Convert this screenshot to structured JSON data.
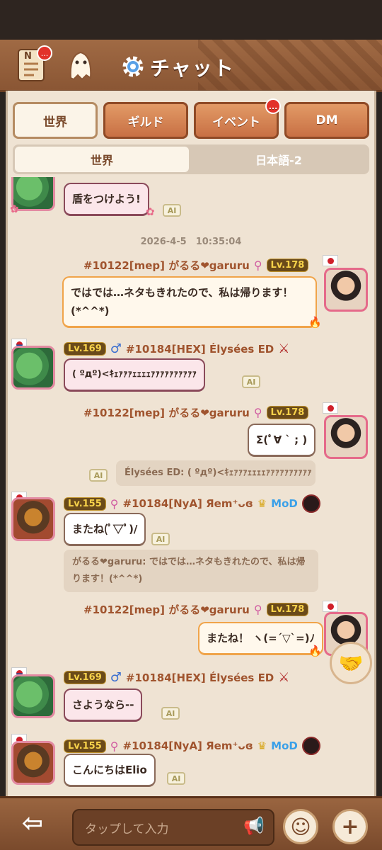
{
  "header": {
    "title": "チャット",
    "news_badge": "...",
    "news_icon_letter": "N"
  },
  "tabs": [
    {
      "label": "世界",
      "active": true
    },
    {
      "label": "ギルド",
      "active": false
    },
    {
      "label": "イベント",
      "active": false,
      "badge": "..."
    },
    {
      "label": "DM",
      "active": false
    }
  ],
  "subtabs": [
    {
      "label": "世界",
      "active": true
    },
    {
      "label": "日本語-2",
      "active": false
    }
  ],
  "ai_label": "AI",
  "messages": {
    "m0": {
      "text": "盾をつけよう!"
    },
    "timestamp": "2026-4-5　10:35:04",
    "m1": {
      "name": "#10122[mep] がるる❤garuru",
      "level": "Lv.178",
      "text": "ではでは…ネタもきれたので、私は帰ります！(*^^*)"
    },
    "m2": {
      "name": "#10184[HEX] Élysées ED",
      "level": "Lv.169",
      "text": "( ºдº)<ｷｪｧｧｧｪｪｪｪｧｧｧｧｧｧｧｧｧｧ"
    },
    "m3": {
      "name": "#10122[mep] がるる❤garuru",
      "level": "Lv.178",
      "text": "Σ(ﾟ∀ ` ; )"
    },
    "q1": {
      "text": "Élysées ED: ( ºдº)<ｷｪｧｧｧｪｪｪｪｧｧｧｧｧｧｧｧｧｧ"
    },
    "m4": {
      "name": "#10184[NyA] Яem⁺ᴗɞ",
      "level": "Lv.155",
      "mod": "MoD",
      "text": "またね(ﾟ▽ﾟ)/"
    },
    "q2": {
      "text": "がるる❤garuru: ではでは…ネタもきれたので、私は帰ります！(*^^*)"
    },
    "m5": {
      "name": "#10122[mep] がるる❤garuru",
      "level": "Lv.178",
      "text": "またね！ ヽ(=´▽`=)ﾉ"
    },
    "m6": {
      "name": "#10184[HEX] Élysées ED",
      "level": "Lv.169",
      "text": "さようなら--"
    },
    "m7": {
      "name": "#10184[NyA] Яem⁺ᴗɞ",
      "level": "Lv.155",
      "mod": "MoD",
      "text": "こんにちはElio"
    }
  },
  "input": {
    "placeholder": "タップして入力"
  }
}
